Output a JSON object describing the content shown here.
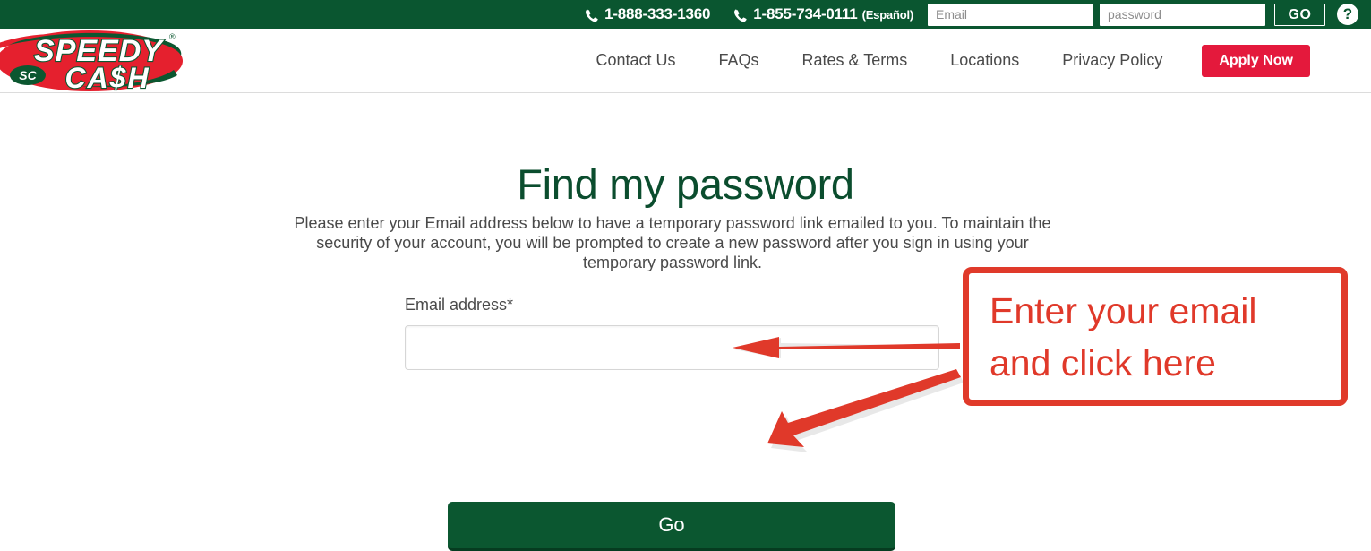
{
  "topbar": {
    "phone_icon": "phone-icon",
    "phone_primary": "1-888-333-1360",
    "phone_secondary": "1-855-734-0111",
    "phone_secondary_note": "(Español)",
    "email_placeholder": "Email",
    "email_value": "",
    "password_placeholder": "password",
    "password_value": "",
    "go_label": "GO",
    "help_icon": "question-mark-icon",
    "help_label": "?",
    "bg_color": "#0a5630"
  },
  "logo": {
    "name": "speedy-cash-logo",
    "line1": "SPEEDY",
    "line2": "CA$H",
    "badge": "SC",
    "trademark": "®",
    "red": "#e5202e",
    "green": "#0b5730"
  },
  "nav": {
    "items": [
      {
        "label": "Contact Us",
        "name": "nav-contact-us"
      },
      {
        "label": "FAQs",
        "name": "nav-faqs"
      },
      {
        "label": "Rates & Terms",
        "name": "nav-rates-terms"
      },
      {
        "label": "Locations",
        "name": "nav-locations"
      },
      {
        "label": "Privacy Policy",
        "name": "nav-privacy-policy"
      }
    ],
    "apply_label": "Apply Now",
    "apply_color": "#e4193c"
  },
  "main": {
    "heading": "Find my password",
    "heading_color": "#0b4d2e",
    "paragraph": "Please enter your Email address below to have a temporary password link emailed to you. To maintain the security of your account, you will be prompted to create a new password after you sign in using your temporary password link.",
    "email_label": "Email address*",
    "email_placeholder": "",
    "email_value": "",
    "submit_label": "Go",
    "submit_color": "#0b5730"
  },
  "annotation": {
    "text_line1": "Enter your email",
    "text_line2": "and click here",
    "color": "#e0392a",
    "arrow_to_input": "arrow-left-icon",
    "arrow_to_button": "arrow-diagonal-icon"
  }
}
